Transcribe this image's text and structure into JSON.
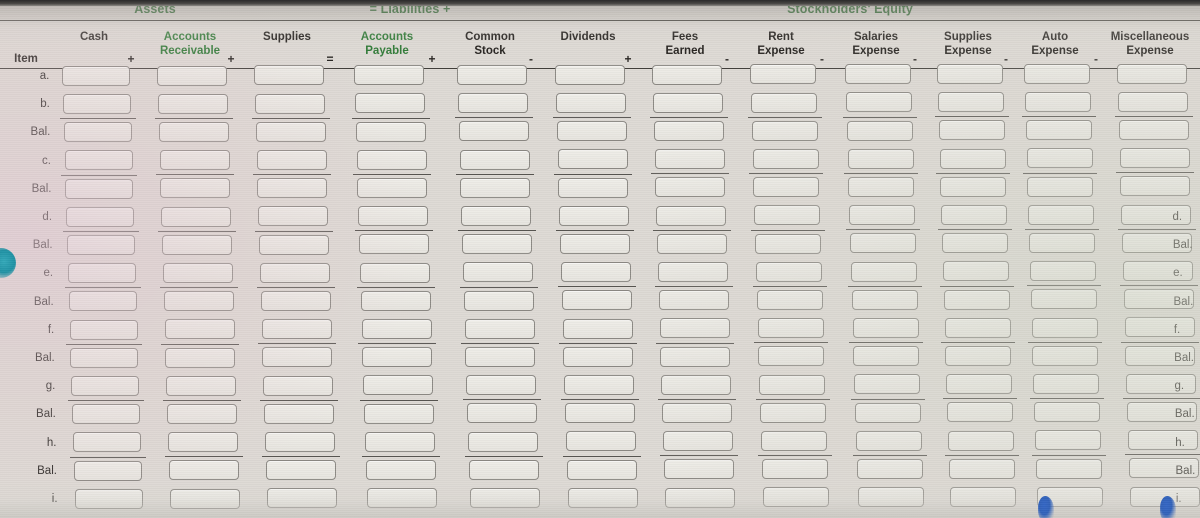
{
  "worksheet": {
    "title_bands": [
      {
        "name": "assets",
        "label": "Assets"
      },
      {
        "name": "liabilities",
        "label": "= Liabilities +"
      },
      {
        "name": "stockholders-equity",
        "label": "Stockholders' Equity"
      }
    ],
    "item_column_header": "Item",
    "columns": [
      {
        "key": "cash",
        "line1": "",
        "line2": "Cash",
        "green": false,
        "operator_before": ""
      },
      {
        "key": "accounts_receivable",
        "line1": "Accounts",
        "line2": "Receivable",
        "green": true,
        "operator_before": "+"
      },
      {
        "key": "supplies",
        "line1": "",
        "line2": "Supplies",
        "green": false,
        "operator_before": "+"
      },
      {
        "key": "accounts_payable",
        "line1": "Accounts",
        "line2": "Payable",
        "green": true,
        "operator_before": "="
      },
      {
        "key": "common_stock",
        "line1": "Common",
        "line2": "Stock",
        "green": false,
        "operator_before": "+"
      },
      {
        "key": "dividends",
        "line1": "",
        "line2": "Dividends",
        "green": false,
        "operator_before": "-"
      },
      {
        "key": "fees_earned",
        "line1": "Fees",
        "line2": "Earned",
        "green": false,
        "operator_before": "+"
      },
      {
        "key": "rent_expense",
        "line1": "Rent",
        "line2": "Expense",
        "green": false,
        "operator_before": "-"
      },
      {
        "key": "salaries_expense",
        "line1": "Salaries",
        "line2": "Expense",
        "green": false,
        "operator_before": "-"
      },
      {
        "key": "supplies_expense",
        "line1": "Supplies",
        "line2": "Expense",
        "green": false,
        "operator_before": "-"
      },
      {
        "key": "auto_expense",
        "line1": "Auto",
        "line2": "Expense",
        "green": false,
        "operator_before": "-"
      },
      {
        "key": "misc_expense",
        "line1": "Miscellaneous",
        "line2": "Expense",
        "green": false,
        "operator_before": "-"
      }
    ],
    "rows": [
      {
        "label": "a.",
        "divider_above": false,
        "values": [
          "",
          "",
          "",
          "",
          "",
          "",
          "",
          "",
          "",
          "",
          "",
          ""
        ]
      },
      {
        "label": "b.",
        "divider_above": false,
        "values": [
          "",
          "",
          "",
          "",
          "",
          "",
          "",
          "",
          "",
          "",
          "",
          ""
        ]
      },
      {
        "label": "Bal.",
        "divider_above": true,
        "values": [
          "",
          "",
          "",
          "",
          "",
          "",
          "",
          "",
          "",
          "",
          "",
          ""
        ]
      },
      {
        "label": "c.",
        "divider_above": false,
        "values": [
          "",
          "",
          "",
          "",
          "",
          "",
          "",
          "",
          "",
          "",
          "",
          ""
        ]
      },
      {
        "label": "Bal.",
        "divider_above": true,
        "values": [
          "",
          "",
          "",
          "",
          "",
          "",
          "",
          "",
          "",
          "",
          "",
          ""
        ]
      },
      {
        "label": "d.",
        "divider_above": false,
        "values": [
          "",
          "",
          "",
          "",
          "",
          "",
          "",
          "",
          "",
          "",
          "",
          ""
        ]
      },
      {
        "label": "Bal.",
        "divider_above": true,
        "values": [
          "",
          "",
          "",
          "",
          "",
          "",
          "",
          "",
          "",
          "",
          "",
          ""
        ]
      },
      {
        "label": "e.",
        "divider_above": false,
        "values": [
          "",
          "",
          "",
          "",
          "",
          "",
          "",
          "",
          "",
          "",
          "",
          ""
        ]
      },
      {
        "label": "Bal.",
        "divider_above": true,
        "values": [
          "",
          "",
          "",
          "",
          "",
          "",
          "",
          "",
          "",
          "",
          "",
          ""
        ]
      },
      {
        "label": "f.",
        "divider_above": false,
        "values": [
          "",
          "",
          "",
          "",
          "",
          "",
          "",
          "",
          "",
          "",
          "",
          ""
        ]
      },
      {
        "label": "Bal.",
        "divider_above": true,
        "values": [
          "",
          "",
          "",
          "",
          "",
          "",
          "",
          "",
          "",
          "",
          "",
          ""
        ]
      },
      {
        "label": "g.",
        "divider_above": false,
        "values": [
          "",
          "",
          "",
          "",
          "",
          "",
          "",
          "",
          "",
          "",
          "",
          ""
        ]
      },
      {
        "label": "Bal.",
        "divider_above": true,
        "values": [
          "",
          "",
          "",
          "",
          "",
          "",
          "",
          "",
          "",
          "",
          "",
          ""
        ]
      },
      {
        "label": "h.",
        "divider_above": false,
        "values": [
          "",
          "",
          "",
          "",
          "",
          "",
          "",
          "",
          "",
          "",
          "",
          ""
        ]
      },
      {
        "label": "Bal.",
        "divider_above": true,
        "values": [
          "",
          "",
          "",
          "",
          "",
          "",
          "",
          "",
          "",
          "",
          "",
          ""
        ]
      },
      {
        "label": "i.",
        "divider_above": false,
        "values": [
          "",
          "",
          "",
          "",
          "",
          "",
          "",
          "",
          "",
          "",
          "",
          ""
        ]
      }
    ],
    "edge_labels": [
      "",
      "",
      "",
      "",
      "",
      "d.",
      "Bal.",
      "e.",
      "Bal.",
      "f.",
      "Bal.",
      "g.",
      "Bal.",
      "h.",
      "Bal.",
      "i."
    ],
    "colors": {
      "header_green": "#2f7a36",
      "header_dark": "#24211e",
      "page_background": "#ddd9d4",
      "cell_border": "#8a8782",
      "rule": "#3e3c38"
    }
  }
}
